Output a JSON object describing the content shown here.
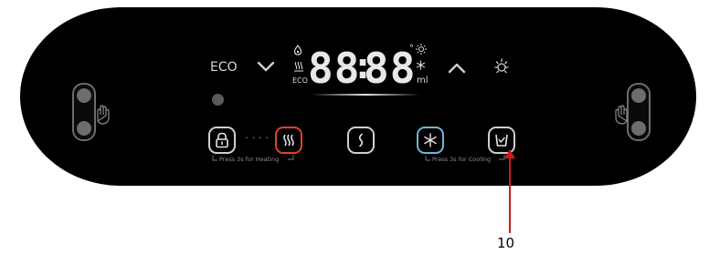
{
  "panel": {
    "eco_label": "ECO",
    "display": {
      "digits_left": "88",
      "colon": ":",
      "digits_right": "88",
      "degree_mark": "°",
      "eco_small": "ECO",
      "ml_unit": "ml"
    },
    "buttons": [
      {
        "name": "lock-button",
        "icon": "lock-icon"
      },
      {
        "name": "heating-button",
        "icon": "heating-icon"
      },
      {
        "name": "flow-button",
        "icon": "flow-icon"
      },
      {
        "name": "cooling-button",
        "icon": "snowflake-icon"
      },
      {
        "name": "cup-button",
        "icon": "cup-icon"
      }
    ],
    "separator_dots": "····",
    "press_heating_hint": "Press 3s for Heating",
    "press_cooling_hint": "Press 3s for Cooling"
  },
  "callout": {
    "number": "10"
  },
  "colors": {
    "panel": "#000000",
    "heat_accent": "#e0402a",
    "cool_accent": "#6db4d8",
    "callout": "#cc1a1a"
  }
}
